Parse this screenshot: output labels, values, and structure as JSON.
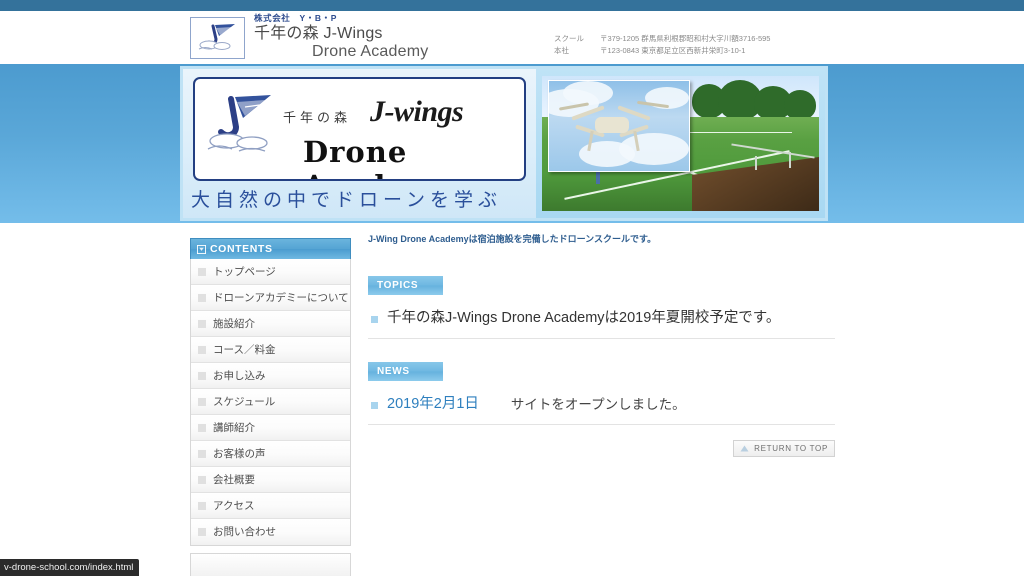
{
  "header": {
    "logo_icon": "j-wing-cloud-logo",
    "company_label": "株式会社　Y・B・P",
    "name_jp": "千年の森 J-Wings",
    "name_en": "Drone Academy",
    "addresses": [
      {
        "label": "スクール",
        "value": "〒379-1205 群馬県利根郡昭和村大字川額3716-595"
      },
      {
        "label": "本社",
        "value": "〒123-0843 東京都足立区西新井栄町3-10-1"
      }
    ]
  },
  "banner": {
    "plate_jp": "千年の森",
    "plate_jwings": "J-wings",
    "plate_academy": "Drone  Academy",
    "tagline": "大自然の中でドローンを学ぶ",
    "photo_alt": "drone-over-field-photo",
    "inset_alt": "drone-closeup-photo"
  },
  "sidebar": {
    "heading": "CONTENTS",
    "heading_icon": "contents-icon",
    "items": [
      {
        "label": "トップページ"
      },
      {
        "label": "ドローンアカデミーについて"
      },
      {
        "label": "施設紹介"
      },
      {
        "label": "コース／料金"
      },
      {
        "label": "お申し込み"
      },
      {
        "label": "スケジュール"
      },
      {
        "label": "講師紹介"
      },
      {
        "label": "お客様の声"
      },
      {
        "label": "会社概要"
      },
      {
        "label": "アクセス"
      },
      {
        "label": "お問い合わせ"
      }
    ]
  },
  "main": {
    "lead": "J-Wing Drone Academyは宿泊施設を完備したドローンスクールです。",
    "topics": {
      "badge": "TOPICS",
      "items": [
        {
          "text": "千年の森J-Wings Drone Academyは2019年夏開校予定です。"
        }
      ]
    },
    "news": {
      "badge": "NEWS",
      "items": [
        {
          "date": "2019年2月1日",
          "text": "サイトをオープンしました。"
        }
      ]
    },
    "return_to_top": "RETURN TO TOP",
    "return_to_top_icon": "up-arrow-icon"
  },
  "statusbar": {
    "url": "v-drone-school.com/index.html"
  },
  "colors": {
    "topbar": "#34729b",
    "band_top": "#4c9bcf",
    "band_bottom": "#74bdea",
    "badge": "#6fb8e2",
    "accent_text": "#2e7fbe",
    "brand_blue": "#2f4d8f"
  }
}
